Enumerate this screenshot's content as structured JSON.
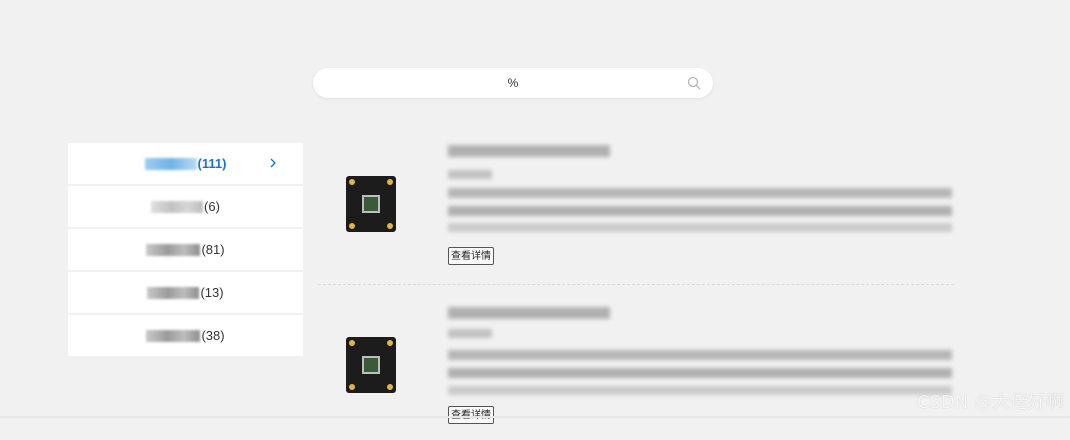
{
  "search": {
    "value": "%"
  },
  "categories": [
    {
      "count": "(111)",
      "active": true
    },
    {
      "count": "(6)"
    },
    {
      "count": "(81)"
    },
    {
      "count": "(13)"
    },
    {
      "count": "(38)"
    }
  ],
  "products": [
    {
      "detail_label": "查看详情"
    },
    {
      "detail_label": "查看详情"
    }
  ],
  "watermark": "CSDN @大佬好啊",
  "colors": {
    "background": "#f1f1f1",
    "active_accent": "#1f6fd1"
  }
}
